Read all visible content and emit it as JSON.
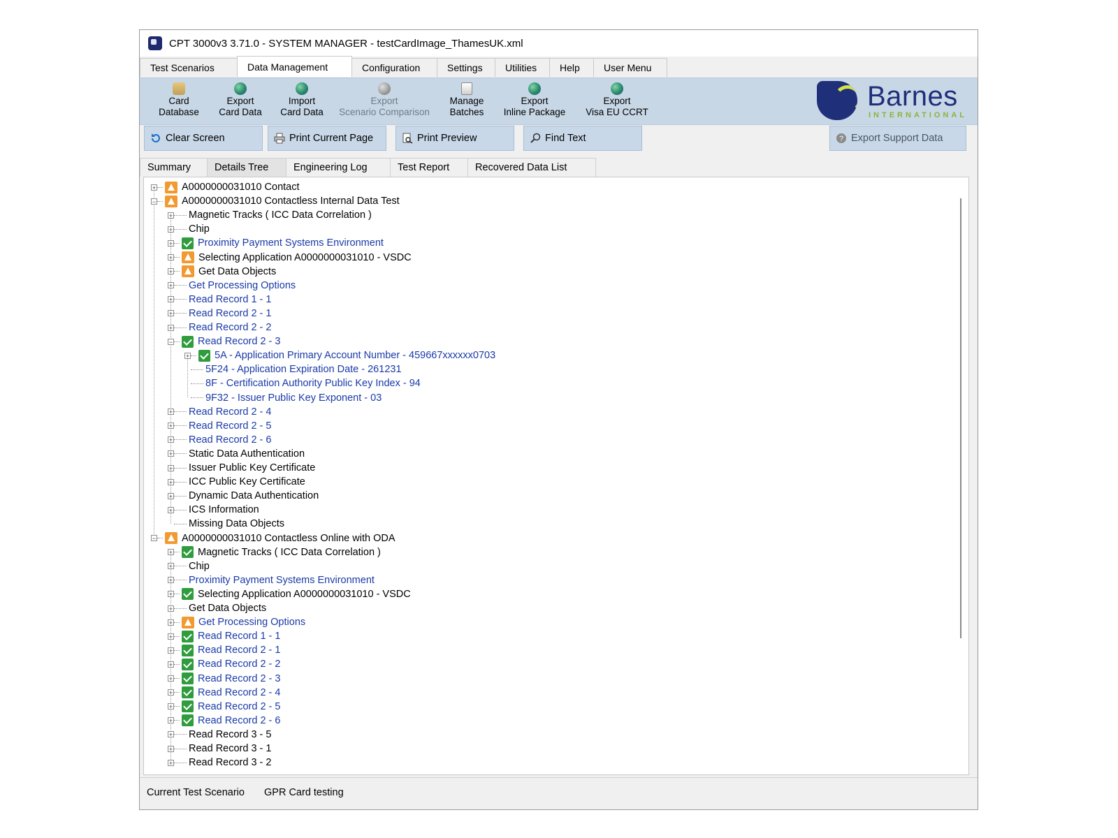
{
  "window": {
    "title": "CPT 3000v3  3.71.0 - SYSTEM MANAGER - testCardImage_ThamesUK.xml"
  },
  "menu": {
    "tabs": [
      {
        "label": "Test Scenarios"
      },
      {
        "label": "Data Management"
      },
      {
        "label": "Configuration"
      },
      {
        "label": "Settings"
      },
      {
        "label": "Utilities"
      },
      {
        "label": "Help"
      },
      {
        "label": "User Menu"
      }
    ],
    "active": "Data Management"
  },
  "ribbon": {
    "buttons": [
      {
        "line1": "Card",
        "line2": "Database",
        "icon": "database-icon"
      },
      {
        "line1": "Export",
        "line2": "Card Data",
        "icon": "globe-icon"
      },
      {
        "line1": "Import",
        "line2": "Card Data",
        "icon": "globe-icon"
      },
      {
        "line1": "Export",
        "line2": "Scenario Comparison",
        "icon": "globe-icon",
        "disabled": true
      },
      {
        "line1": "Manage",
        "line2": "Batches",
        "icon": "documents-icon"
      },
      {
        "line1": "Export",
        "line2": "Inline Package",
        "icon": "globe-icon"
      },
      {
        "line1": "Export",
        "line2": "Visa EU CCRT",
        "icon": "globe-icon"
      }
    ],
    "logo": {
      "word": "Barnes",
      "sub": "INTERNATIONAL",
      "color": "#1f2f7a",
      "accent": "#d3e34a"
    }
  },
  "toolbar": {
    "clear_screen": "Clear Screen",
    "print_current_page": "Print Current Page",
    "print_preview": "Print Preview",
    "find_text": "Find Text",
    "export_support_data": "Export Support Data"
  },
  "subtabs": [
    {
      "label": "Summary"
    },
    {
      "label": "Details Tree"
    },
    {
      "label": "Engineering Log"
    },
    {
      "label": "Test Report"
    },
    {
      "label": "Recovered Data List"
    }
  ],
  "subtabs_active": "Details Tree",
  "tree": [
    {
      "level": 0,
      "toggle": "+",
      "status": "warn",
      "text": "A0000000031010 Contact",
      "color": "black"
    },
    {
      "level": 0,
      "toggle": "-",
      "status": "warn",
      "text": "A0000000031010 Contactless Internal Data Test",
      "color": "black"
    },
    {
      "level": 1,
      "toggle": "+",
      "status": "none",
      "text": "Magnetic Tracks ( ICC Data Correlation )",
      "color": "black"
    },
    {
      "level": 1,
      "toggle": "+",
      "status": "none",
      "text": "Chip",
      "color": "black"
    },
    {
      "level": 1,
      "toggle": "+",
      "status": "ok",
      "text": "Proximity Payment Systems Environment",
      "color": "blue"
    },
    {
      "level": 1,
      "toggle": "+",
      "status": "warn",
      "text": "Selecting Application A0000000031010 - VSDC",
      "color": "black"
    },
    {
      "level": 1,
      "toggle": "+",
      "status": "warn",
      "text": "Get Data Objects",
      "color": "black"
    },
    {
      "level": 1,
      "toggle": "+",
      "status": "none",
      "text": "Get Processing Options",
      "color": "blue"
    },
    {
      "level": 1,
      "toggle": "+",
      "status": "none",
      "text": "Read Record 1 - 1",
      "color": "blue"
    },
    {
      "level": 1,
      "toggle": "+",
      "status": "none",
      "text": "Read Record 2 - 1",
      "color": "blue"
    },
    {
      "level": 1,
      "toggle": "+",
      "status": "none",
      "text": "Read Record 2 - 2",
      "color": "blue"
    },
    {
      "level": 1,
      "toggle": "-",
      "status": "ok",
      "text": "Read Record 2 - 3",
      "color": "blue"
    },
    {
      "level": 2,
      "toggle": "+",
      "status": "ok",
      "text": "5A - Application Primary Account Number - 459667xxxxxx0703",
      "color": "blue"
    },
    {
      "level": 2,
      "toggle": "none",
      "status": "none",
      "text": "5F24 - Application Expiration Date - 261231",
      "color": "blue"
    },
    {
      "level": 2,
      "toggle": "none",
      "status": "none",
      "text": "8F - Certification Authority Public Key Index - 94",
      "color": "blue"
    },
    {
      "level": 2,
      "toggle": "none",
      "status": "none",
      "text": "9F32 - Issuer Public Key Exponent - 03",
      "color": "blue"
    },
    {
      "level": 1,
      "toggle": "+",
      "status": "none",
      "text": "Read Record 2 - 4",
      "color": "blue"
    },
    {
      "level": 1,
      "toggle": "+",
      "status": "none",
      "text": "Read Record 2 - 5",
      "color": "blue"
    },
    {
      "level": 1,
      "toggle": "+",
      "status": "none",
      "text": "Read Record 2 - 6",
      "color": "blue"
    },
    {
      "level": 1,
      "toggle": "+",
      "status": "none",
      "text": "Static Data Authentication",
      "color": "black"
    },
    {
      "level": 1,
      "toggle": "+",
      "status": "none",
      "text": "Issuer Public Key Certificate",
      "color": "black"
    },
    {
      "level": 1,
      "toggle": "+",
      "status": "none",
      "text": "ICC Public Key Certificate",
      "color": "black"
    },
    {
      "level": 1,
      "toggle": "+",
      "status": "none",
      "text": "Dynamic Data Authentication",
      "color": "black"
    },
    {
      "level": 1,
      "toggle": "+",
      "status": "none",
      "text": "ICS Information",
      "color": "black"
    },
    {
      "level": 1,
      "toggle": "none",
      "status": "none",
      "text": "Missing Data Objects",
      "color": "black"
    },
    {
      "level": 0,
      "toggle": "-",
      "status": "warn",
      "text": "A0000000031010 Contactless Online with ODA",
      "color": "black"
    },
    {
      "level": 1,
      "toggle": "+",
      "status": "ok",
      "text": "Magnetic Tracks ( ICC Data Correlation )",
      "color": "black"
    },
    {
      "level": 1,
      "toggle": "+",
      "status": "none",
      "text": "Chip",
      "color": "black"
    },
    {
      "level": 1,
      "toggle": "+",
      "status": "none",
      "text": "Proximity Payment Systems Environment",
      "color": "blue"
    },
    {
      "level": 1,
      "toggle": "+",
      "status": "ok",
      "text": "Selecting Application A0000000031010 - VSDC",
      "color": "black"
    },
    {
      "level": 1,
      "toggle": "+",
      "status": "none",
      "text": "Get Data Objects",
      "color": "black"
    },
    {
      "level": 1,
      "toggle": "+",
      "status": "warn",
      "text": "Get Processing Options",
      "color": "blue"
    },
    {
      "level": 1,
      "toggle": "+",
      "status": "ok",
      "text": "Read Record 1 - 1",
      "color": "blue"
    },
    {
      "level": 1,
      "toggle": "+",
      "status": "ok",
      "text": "Read Record 2 - 1",
      "color": "blue"
    },
    {
      "level": 1,
      "toggle": "+",
      "status": "ok",
      "text": "Read Record 2 - 2",
      "color": "blue"
    },
    {
      "level": 1,
      "toggle": "+",
      "status": "ok",
      "text": "Read Record 2 - 3",
      "color": "blue"
    },
    {
      "level": 1,
      "toggle": "+",
      "status": "ok",
      "text": "Read Record 2 - 4",
      "color": "blue"
    },
    {
      "level": 1,
      "toggle": "+",
      "status": "ok",
      "text": "Read Record 2 - 5",
      "color": "blue"
    },
    {
      "level": 1,
      "toggle": "+",
      "status": "ok",
      "text": "Read Record 2 - 6",
      "color": "blue"
    },
    {
      "level": 1,
      "toggle": "+",
      "status": "none",
      "text": "Read Record 3 - 5",
      "color": "black"
    },
    {
      "level": 1,
      "toggle": "+",
      "status": "none",
      "text": "Read Record 3 - 1",
      "color": "black"
    },
    {
      "level": 1,
      "toggle": "+",
      "status": "none",
      "text": "Read Record 3 - 2",
      "color": "black"
    }
  ],
  "statusbar": {
    "label": "Current Test Scenario",
    "value": "GPR Card testing"
  },
  "colors": {
    "ribbon_bg": "#c8d7e6",
    "tree_blue_text": "#1a3aa8",
    "status_ok": "#2f9c3e",
    "status_warn": "#f29a31"
  }
}
